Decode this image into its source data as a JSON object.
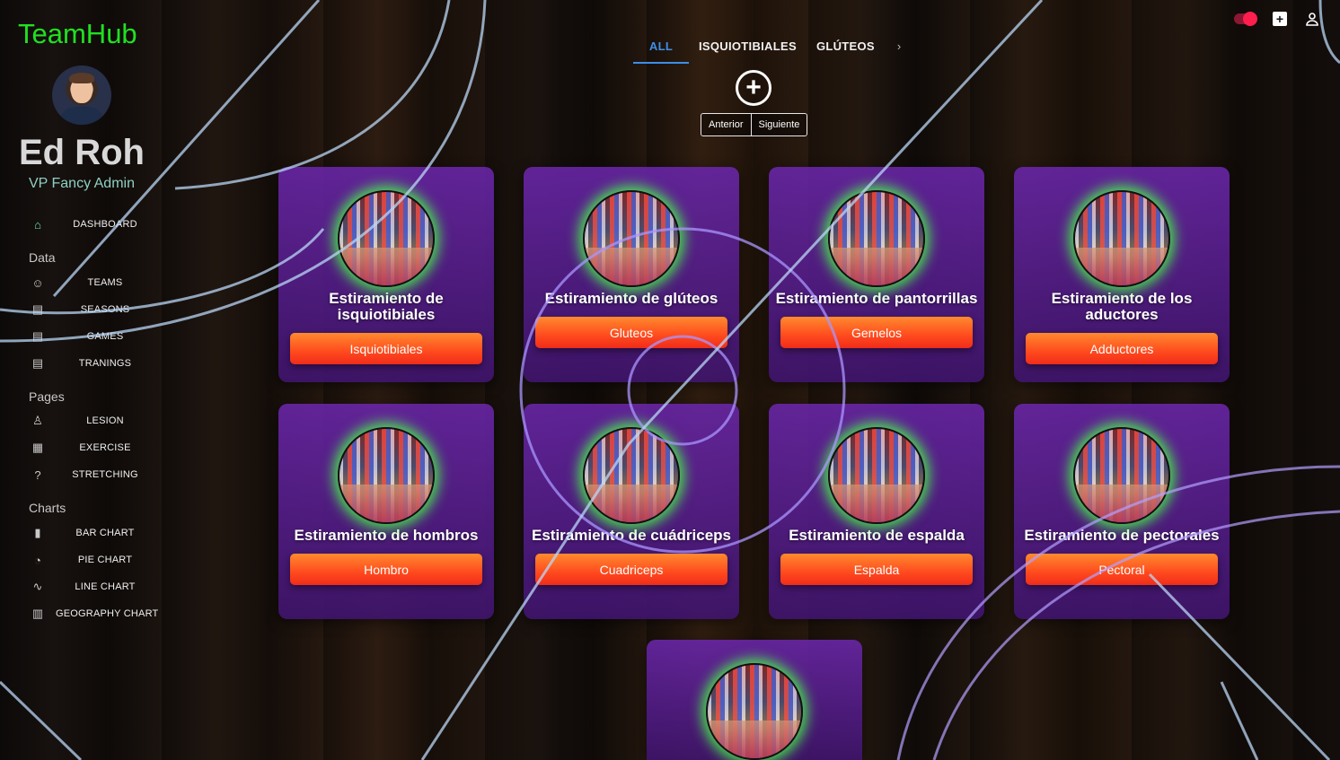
{
  "app": {
    "logo": "TeamHub"
  },
  "user": {
    "name": "Ed Roh",
    "role": "VP Fancy Admin"
  },
  "sidebar": {
    "top_item": {
      "label": "DASHBOARD",
      "icon": "home-icon"
    },
    "sections": [
      {
        "title": "Data",
        "items": [
          {
            "label": "TEAMS",
            "icon": "people-icon"
          },
          {
            "label": "SEASONS",
            "icon": "contacts-icon"
          },
          {
            "label": "GAMES",
            "icon": "receipt-icon"
          },
          {
            "label": "TRANINGS",
            "icon": "receipt-icon"
          }
        ]
      },
      {
        "title": "Pages",
        "items": [
          {
            "label": "LESION",
            "icon": "person-icon"
          },
          {
            "label": "EXERCISE",
            "icon": "calendar-icon"
          },
          {
            "label": "STRETCHING",
            "icon": "help-icon"
          }
        ]
      },
      {
        "title": "Charts",
        "items": [
          {
            "label": "BAR CHART",
            "icon": "bar-chart-icon"
          },
          {
            "label": "PIE CHART",
            "icon": "pie-chart-icon"
          },
          {
            "label": "LINE CHART",
            "icon": "timeline-icon"
          },
          {
            "label": "GEOGRAPHY CHART",
            "icon": "map-icon"
          }
        ]
      }
    ]
  },
  "tabs": [
    {
      "label": "ALL",
      "active": true
    },
    {
      "label": "ISQUIOTIBIALES",
      "active": false
    },
    {
      "label": "GLÚTEOS",
      "active": false
    }
  ],
  "tabs_scroll_icon": "›",
  "add_button": "+",
  "pager": {
    "prev": "Anterior",
    "next": "Siguiente"
  },
  "topbar": {
    "theme_toggle": "on",
    "icons": [
      "toggle-icon",
      "add-box-icon",
      "person-icon"
    ]
  },
  "cards": [
    {
      "title": "Estiramiento de isquiotibiales",
      "button": "Isquiotibiales"
    },
    {
      "title": "Estiramiento de glúteos",
      "button": "Gluteos"
    },
    {
      "title": "Estiramiento de pantorrillas",
      "button": "Gemelos"
    },
    {
      "title": "Estiramiento de los aductores",
      "button": "Adductores"
    },
    {
      "title": "Estiramiento de hombros",
      "button": "Hombro"
    },
    {
      "title": "Estiramiento de cuádriceps",
      "button": "Cuadriceps"
    },
    {
      "title": "Estiramiento de espalda",
      "button": "Espalda"
    },
    {
      "title": "Estiramiento de pectorales",
      "button": "Pectoral"
    },
    {
      "title": "",
      "button": ""
    }
  ],
  "colors": {
    "logo": "#21e021",
    "accent_tab": "#3d8ee8",
    "card_bg": "#6a26aa",
    "button_gradient_top": "#ff8a2e",
    "button_gradient_bottom": "#f02c1a",
    "thumb_glow": "#46ff46",
    "toggle": "#ff1e4e"
  }
}
